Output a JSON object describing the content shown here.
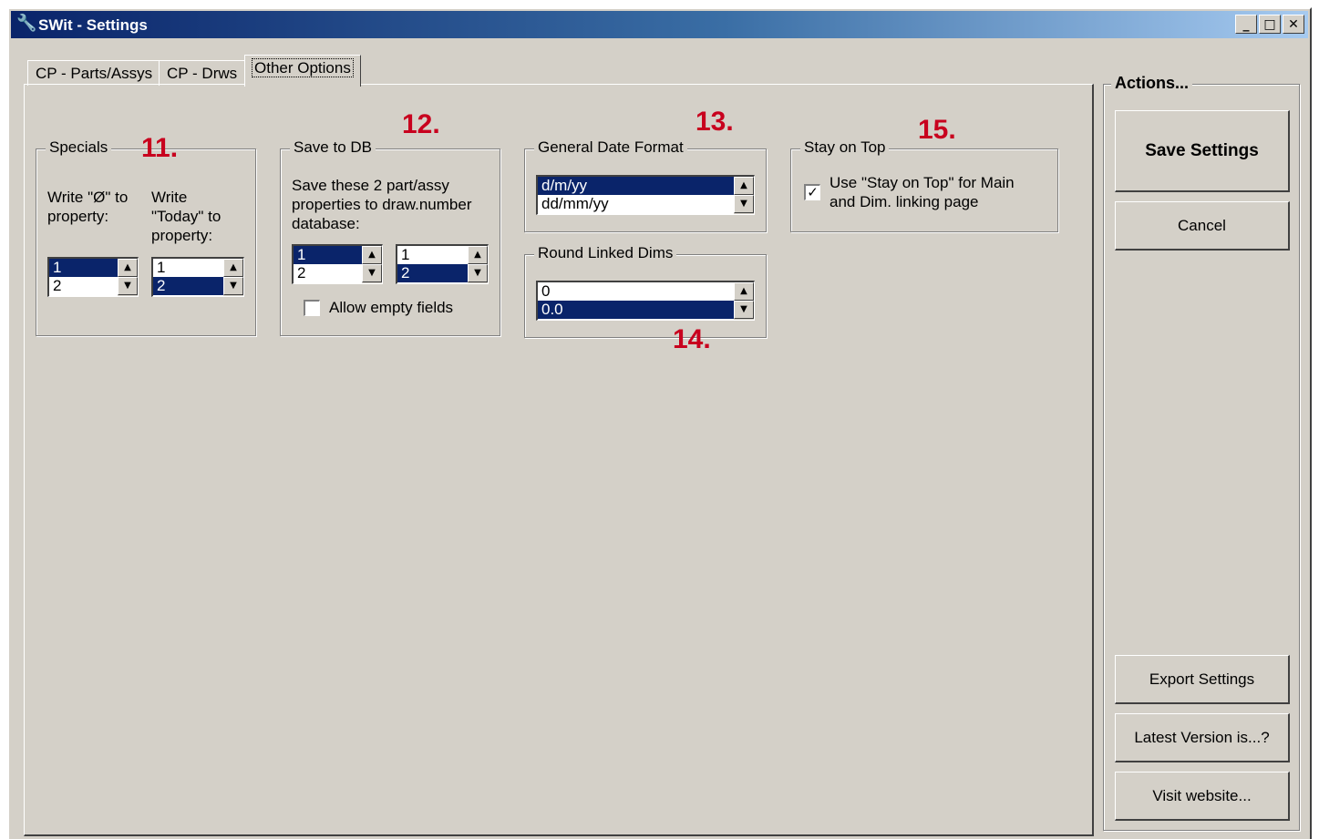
{
  "window": {
    "title": "SWit - Settings",
    "controls": {
      "minimize": "_",
      "maximize": "□",
      "close": "✕"
    }
  },
  "tabs": [
    "CP - Parts/Assys",
    "CP - Drws",
    "Other Options"
  ],
  "annotations": [
    "11.",
    "12.",
    "13.",
    "14.",
    "15."
  ],
  "specials": {
    "legend": "Specials",
    "write_zero_label": [
      "Write \"Ø\" to",
      "property:"
    ],
    "write_today_label": [
      "Write",
      "\"Today\" to",
      "property:"
    ],
    "zero_list": {
      "items": [
        "1",
        "2"
      ],
      "selected": 0
    },
    "today_list": {
      "items": [
        "1",
        "2"
      ],
      "selected": 1
    }
  },
  "save_to_db": {
    "legend": "Save to DB",
    "description": [
      "Save these 2 part/assy",
      "properties to draw.number",
      "database:"
    ],
    "list_a": {
      "items": [
        "1",
        "2"
      ],
      "selected": 0
    },
    "list_b": {
      "items": [
        "1",
        "2"
      ],
      "selected": 1
    },
    "allow_empty_label": "Allow empty fields",
    "allow_empty_checked": false
  },
  "date_format": {
    "legend": "General Date Format",
    "list": {
      "items": [
        "d/m/yy",
        "dd/mm/yy"
      ],
      "selected": 0
    }
  },
  "round_dims": {
    "legend": "Round Linked Dims",
    "list": {
      "items": [
        "0",
        "0.0"
      ],
      "selected": 1
    }
  },
  "stay_on_top": {
    "legend": "Stay on Top",
    "label": [
      "Use \"Stay on Top\" for Main",
      "and Dim. linking page"
    ],
    "checked": true,
    "check_mark": "✓"
  },
  "actions": {
    "legend": "Actions...",
    "save": "Save Settings",
    "cancel": "Cancel",
    "export": "Export Settings",
    "latest": "Latest Version is...?",
    "visit": "Visit website..."
  },
  "colors": {
    "face": "#d4d0c8",
    "selection": "#0a246a",
    "annotation": "#c8001e",
    "title_gradient_start": "#0a246a"
  },
  "icons": {
    "title": "wrench-icon",
    "scroll_up": "▲",
    "scroll_down": "▼"
  }
}
